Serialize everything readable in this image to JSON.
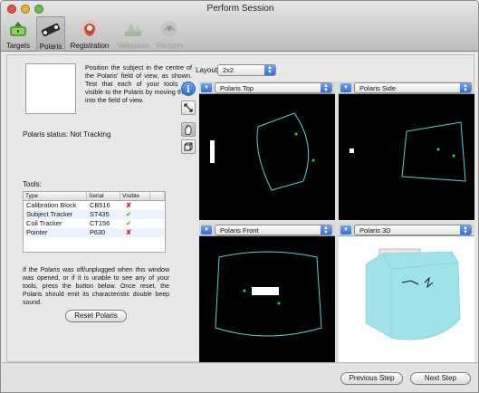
{
  "window": {
    "title": "Perform Session"
  },
  "toolbar": {
    "items": [
      {
        "label": "Targets",
        "icon": "targets-icon"
      },
      {
        "label": "Polaris",
        "icon": "polaris-icon"
      },
      {
        "label": "Registration",
        "icon": "registration-icon"
      },
      {
        "label": "Validation",
        "icon": "validation-icon"
      },
      {
        "label": "Perform",
        "icon": "perform-icon"
      }
    ]
  },
  "left": {
    "instructions": "Position the subject in the centre of the Polaris' field of view, as shown. Test that each of your tools are visible to the Polaris by moving them into the field of view.",
    "status_label": "Polaris status:",
    "status_value": "Not Tracking",
    "tools_label": "Tools:",
    "tools_columns": [
      "Type",
      "Serial",
      "Visible"
    ],
    "tools": [
      {
        "type": "Calibration Block",
        "serial": "CB516",
        "visible": "✘"
      },
      {
        "type": "Subject Tracker",
        "serial": "ST435",
        "visible": "✔"
      },
      {
        "type": "Coil Tracker",
        "serial": "CT156",
        "visible": "✔"
      },
      {
        "type": "Pointer",
        "serial": "P630",
        "visible": "✘"
      }
    ],
    "help": "If the Polaris was off/unplugged when this window was opened, or if it is unable to see any of your tools, press the button below. Once reset, the Polaris should emit its characteristic double beep sound.",
    "reset_label": "Reset Polaris"
  },
  "right": {
    "layout_label": "Layout:",
    "layout_value": "2x2",
    "views": [
      {
        "title": "Polaris Top"
      },
      {
        "title": "Polaris Side"
      },
      {
        "title": "Polaris Front"
      },
      {
        "title": "Polaris 3D"
      }
    ]
  },
  "footer": {
    "prev_label": "Previous Step",
    "next_label": "Next Step"
  },
  "colors": {
    "accent": "#2f6fd6",
    "fov_outline": "#5fd0d0",
    "marker": "#35d13a",
    "x_mark": "#d12b2b",
    "check_mark": "#3aa32f"
  }
}
